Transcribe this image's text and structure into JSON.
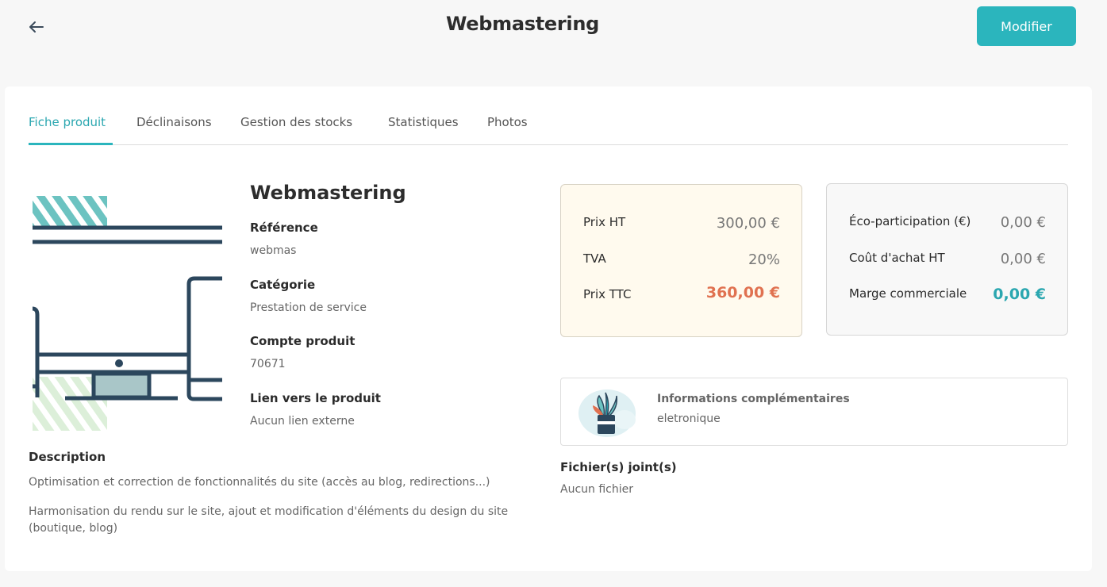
{
  "header": {
    "title": "Webmastering",
    "edit_label": "Modifier"
  },
  "tabs": [
    {
      "label": "Fiche produit",
      "active": true
    },
    {
      "label": "Déclinaisons",
      "active": false
    },
    {
      "label": "Gestion des stocks",
      "active": false
    },
    {
      "label": "Statistiques",
      "active": false
    },
    {
      "label": "Photos",
      "active": false
    }
  ],
  "product": {
    "name": "Webmastering",
    "reference_label": "Référence",
    "reference": "webmas",
    "category_label": "Catégorie",
    "category": "Prestation de service",
    "account_label": "Compte produit",
    "account": "70671",
    "link_label": "Lien vers le produit",
    "link": "Aucun lien externe",
    "description_label": "Description",
    "description": [
      "Optimisation et correction de fonctionnalités du site (accès au blog, redirections...)",
      "Harmonisation du rendu sur le site, ajout et modification d'éléments du design du site (boutique, blog)"
    ]
  },
  "pricing": {
    "price_ht_label": "Prix HT",
    "price_ht": "300,00 €",
    "vat_label": "TVA",
    "vat": "20%",
    "price_ttc_label": "Prix TTC",
    "price_ttc": "360,00 €"
  },
  "costs": {
    "eco_label": "Éco-participation (€)",
    "eco": "0,00 €",
    "purchase_label": "Coût d'achat HT",
    "purchase": "0,00 €",
    "margin_label": "Marge commerciale",
    "margin": "0,00 €"
  },
  "extra_info": {
    "title": "Informations complémentaires",
    "value": "eletronique"
  },
  "files": {
    "label": "Fichier(s) joint(s)",
    "value": "Aucun fichier"
  },
  "colors": {
    "accent": "#2bb5bd",
    "price_ttc": "#e07150",
    "margin": "#2ba7b0"
  }
}
